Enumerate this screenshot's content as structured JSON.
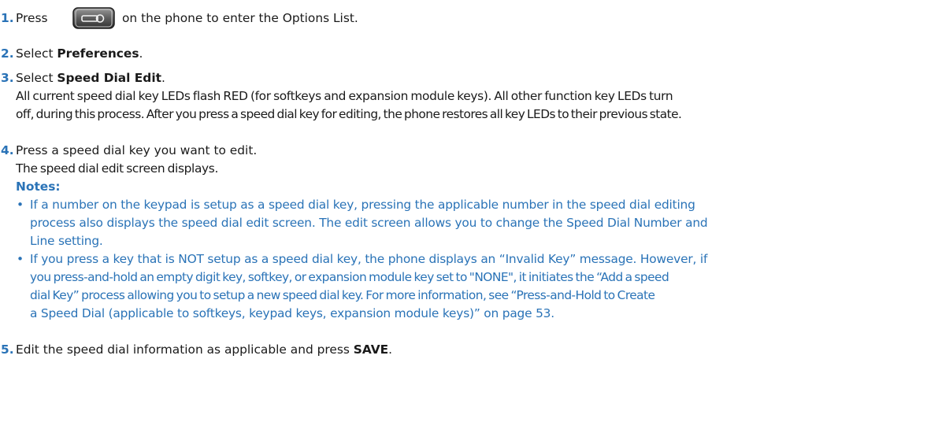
{
  "steps": [
    {
      "number": "1.",
      "parts": {
        "pre": "Press",
        "post": "on the phone to enter the Options List."
      }
    },
    {
      "number": "2.",
      "parts": {
        "pre": "Select ",
        "bold": "Preferences",
        "post": "."
      }
    },
    {
      "number": "3.",
      "parts": {
        "pre": "Select ",
        "bold": "Speed Dial Edit",
        "post": "."
      },
      "body": [
        "All current speed dial key LEDs flash RED (for softkeys and expansion module keys). All other function key LEDs turn",
        "off, during this process. After you press a speed dial key for editing, the phone restores all key LEDs to their previous state."
      ]
    },
    {
      "number": "4.",
      "parts": {
        "pre": "Press a speed dial key you want to edit."
      },
      "body": [
        "The speed dial edit screen displays."
      ],
      "notes_heading": "Notes:",
      "notes": [
        {
          "lines": [
            "If a number on the keypad is setup as a speed dial key, pressing the applicable number in the speed dial editing",
            "process also displays the speed dial edit screen. The edit screen allows you to change the Speed Dial Number and",
            "Line setting."
          ]
        },
        {
          "lines": [
            "If you press a key that is NOT setup as a speed dial key, the phone displays an “Invalid Key” message. However, if",
            "you press-and-hold an empty digit key, softkey, or expansion module key set to \"NONE\", it initiates the “Add a speed",
            "dial Key” process allowing you to setup a new speed dial key. For more information, see "
          ],
          "link_line3": "“Press-and-Hold to Create",
          "link_line4": "a Speed Dial (applicable to softkeys, keypad keys, expansion module keys)” on page 53",
          "end": "."
        }
      ]
    },
    {
      "number": "5.",
      "parts": {
        "pre": "Edit the speed dial information as applicable and press ",
        "bold": "SAVE",
        "post": "."
      }
    }
  ],
  "icons": {
    "options_key": "options-key-icon"
  },
  "colors": {
    "accent": "#2a73b7",
    "text": "#1a1a1a"
  }
}
